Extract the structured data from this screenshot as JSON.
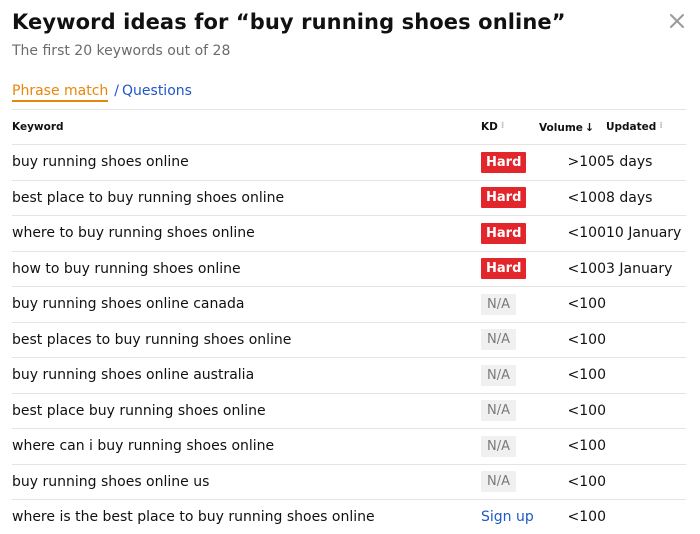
{
  "header": {
    "title": "Keyword ideas for “buy running shoes online”",
    "subtitle": "The first 20 keywords out of 28"
  },
  "tabs": {
    "active": "Phrase match",
    "separator": "/",
    "other": "Questions"
  },
  "table": {
    "columns": {
      "keyword": "Keyword",
      "kd": "KD",
      "volume": "Volume",
      "updated": "Updated"
    },
    "rows": [
      {
        "keyword": "buy running shoes online",
        "kd": "Hard",
        "kd_type": "hard",
        "volume": ">100",
        "updated": "5 days"
      },
      {
        "keyword": "best place to buy running shoes online",
        "kd": "Hard",
        "kd_type": "hard",
        "volume": "<100",
        "updated": "8 days"
      },
      {
        "keyword": "where to buy running shoes online",
        "kd": "Hard",
        "kd_type": "hard",
        "volume": "<100",
        "updated": "10 January"
      },
      {
        "keyword": "how to buy running shoes online",
        "kd": "Hard",
        "kd_type": "hard",
        "volume": "<100",
        "updated": "3 January"
      },
      {
        "keyword": "buy running shoes online canada",
        "kd": "N/A",
        "kd_type": "na",
        "volume": "<100",
        "updated": ""
      },
      {
        "keyword": "best places to buy running shoes online",
        "kd": "N/A",
        "kd_type": "na",
        "volume": "<100",
        "updated": ""
      },
      {
        "keyword": "buy running shoes online australia",
        "kd": "N/A",
        "kd_type": "na",
        "volume": "<100",
        "updated": ""
      },
      {
        "keyword": "best place buy running shoes online",
        "kd": "N/A",
        "kd_type": "na",
        "volume": "<100",
        "updated": ""
      },
      {
        "keyword": "where can i buy running shoes online",
        "kd": "N/A",
        "kd_type": "na",
        "volume": "<100",
        "updated": ""
      },
      {
        "keyword": "buy running shoes online us",
        "kd": "N/A",
        "kd_type": "na",
        "volume": "<100",
        "updated": ""
      },
      {
        "keyword": "where is the best place to buy running shoes online",
        "kd": "Sign up",
        "kd_type": "signup",
        "volume": "<100",
        "updated": ""
      }
    ]
  },
  "icons": {
    "close": "close-icon",
    "sort": "sort-icon",
    "sort_desc": "arrow-down-icon"
  },
  "colors": {
    "accent": "#e8860c",
    "link": "#1f57c7",
    "hard": "#e3262c",
    "na_bg": "#f0f0f0"
  }
}
